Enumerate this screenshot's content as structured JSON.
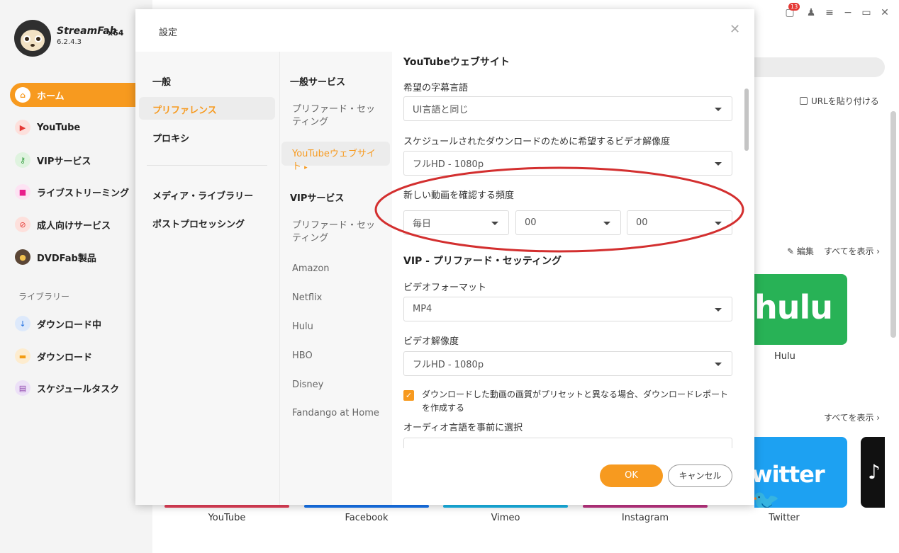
{
  "app": {
    "brand_name": "StreamFab",
    "arch": "x64",
    "version": "6.2.4.3",
    "notification_count": "13"
  },
  "sidebar": {
    "items": [
      {
        "label": "ホーム",
        "icon": "home-icon"
      },
      {
        "label": "YouTube",
        "icon": "youtube-icon"
      },
      {
        "label": "VIPサービス",
        "icon": "key-icon"
      },
      {
        "label": "ライブストリーミング",
        "icon": "camera-icon"
      },
      {
        "label": "成人向けサービス",
        "icon": "adult-icon"
      },
      {
        "label": "DVDFab製品",
        "icon": "dvdfab-icon"
      }
    ],
    "library_title": "ライブラリー",
    "library_items": [
      {
        "label": "ダウンロード中",
        "icon": "download-arrow-icon"
      },
      {
        "label": "ダウンロード",
        "icon": "folder-icon"
      },
      {
        "label": "スケジュールタスク",
        "icon": "schedule-icon"
      }
    ]
  },
  "background": {
    "paste_url": "URLを貼り付ける",
    "edit": "編集",
    "show_all_1": "すべてを表示",
    "show_all_2": "すべてを表示",
    "hulu_logo": "hulu",
    "hulu_caption": "Hulu",
    "twitter_logo": "witter",
    "bottom_captions": [
      "YouTube",
      "Facebook",
      "Vimeo",
      "Instagram",
      "Twitter"
    ]
  },
  "dialog": {
    "title": "設定",
    "col1": {
      "items": [
        "一般",
        "プリファレンス",
        "プロキシ",
        "メディア・ライブラリー",
        "ポストプロセッシング"
      ]
    },
    "col2": {
      "general_head": "一般サービス",
      "general_items": [
        "プリファード・セッティング",
        "YouTubeウェブサイト"
      ],
      "vip_head": "VIPサービス",
      "vip_items": [
        "プリファード・セッティング",
        "Amazon",
        "Netflix",
        "Hulu",
        "HBO",
        "Disney",
        "Fandango at Home"
      ]
    },
    "content": {
      "youtube_section": "YouTubeウェブサイト",
      "subtitle_label": "希望の字幕言語",
      "subtitle_value": "UI言語と同じ",
      "resolution_label": "スケジュールされたダウンロードのために希望するビデオ解像度",
      "resolution_value": "フルHD - 1080p",
      "frequency_label": "新しい動画を確認する頻度",
      "frequency_value": "毎日",
      "hour_value": "00",
      "minute_value": "00",
      "vip_section": "VIP - プリファード・セッティング",
      "format_label": "ビデオフォーマット",
      "format_value": "MP4",
      "vip_resolution_label": "ビデオ解像度",
      "vip_resolution_value": "フルHD - 1080p",
      "report_checkbox": "ダウンロードした動画の画質がプリセットと異なる場合、ダウンロードレポートを作成する",
      "audio_label": "オーディオ言語を事前に選択"
    },
    "ok": "OK",
    "cancel": "キャンセル"
  },
  "colors": {
    "accent": "#f79a1f",
    "annotation": "#d32f2f"
  }
}
